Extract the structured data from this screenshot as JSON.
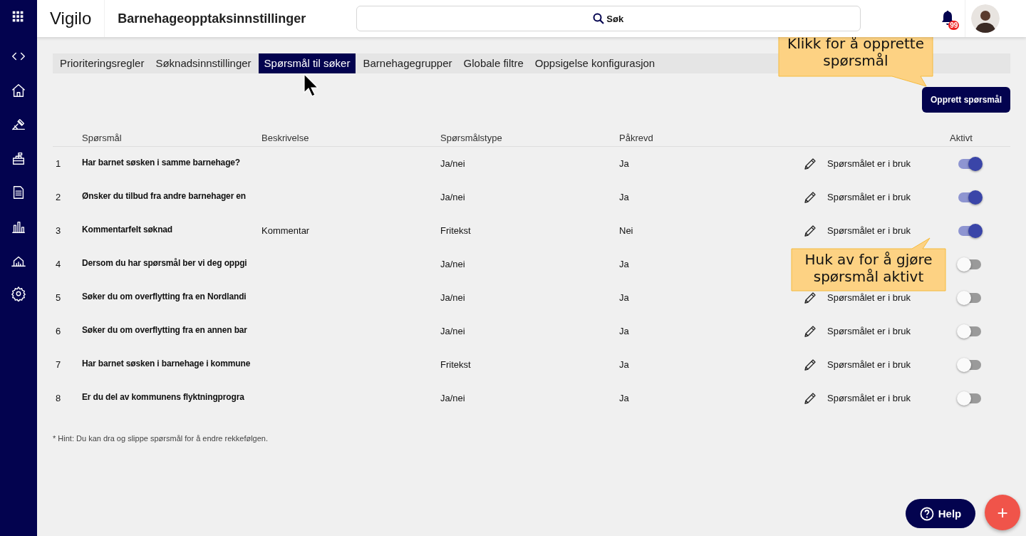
{
  "header": {
    "logo": "Vigilo",
    "title": "Barnehageopptaksinnstillinger",
    "search": {
      "placeholder": "Søk"
    },
    "notification_badge": "99"
  },
  "tabs": [
    {
      "label": "Prioriteringsregler",
      "selected": false
    },
    {
      "label": "Søknadsinnstillinger",
      "selected": false
    },
    {
      "label": "Spørsmål til søker",
      "selected": true
    },
    {
      "label": "Barnehagegrupper",
      "selected": false
    },
    {
      "label": "Globale filtre",
      "selected": false
    },
    {
      "label": "Oppsigelse konfigurasjon",
      "selected": false
    }
  ],
  "create_button": "Opprett spørsmål",
  "table": {
    "columns": [
      "Spørsmål",
      "Beskrivelse",
      "Spørsmålstype",
      "Påkrevd",
      "Aktivt"
    ],
    "rows": [
      {
        "number": "1",
        "question": "Har barnet søsken i samme barnehage?",
        "type": "Ja/nei",
        "required": "Ja",
        "status": "Spørsmålet er i bruk",
        "active": true
      },
      {
        "number": "2",
        "question": "Ønsker du tilbud fra andre barnehager en",
        "type": "Ja/nei",
        "required": "Ja",
        "status": "Spørsmålet er i bruk",
        "active": true
      },
      {
        "number": "3",
        "question": "Kommentarfelt søknad",
        "description": "Kommentar",
        "type": "Fritekst",
        "required": "Nei",
        "status": "Spørsmålet er i bruk",
        "active": true
      },
      {
        "number": "4",
        "question": "Dersom du har spørsmål ber vi deg oppgi",
        "type": "Ja/nei",
        "required": "Ja",
        "active": false
      },
      {
        "number": "5",
        "question": "Søker du om overflytting fra en Nordlandi",
        "type": "Ja/nei",
        "required": "Ja",
        "status": "Spørsmålet er i bruk",
        "active": false
      },
      {
        "number": "6",
        "question": "Søker du om overflytting fra en annen bar",
        "type": "Ja/nei",
        "required": "Ja",
        "status": "Spørsmålet er i bruk",
        "active": false
      },
      {
        "number": "7",
        "question": "Har barnet søsken i barnehage i kommune",
        "type": "Fritekst",
        "required": "Ja",
        "status": "Spørsmålet er i bruk",
        "active": false
      },
      {
        "number": "8",
        "question": "Er du del av kommunens flyktningprogra",
        "type": "Ja/nei",
        "required": "Ja",
        "status": "Spørsmålet er i bruk",
        "active": false
      }
    ]
  },
  "hint": "* Hint: Du kan dra og slippe spørsmål for å endre rekkefølgen.",
  "callouts": [
    {
      "text": "Klikk for å opprette spørsmål"
    },
    {
      "text": "Huk av for å gjøre spørsmål aktivt"
    }
  ],
  "help_button": "Help",
  "add_button": "+"
}
